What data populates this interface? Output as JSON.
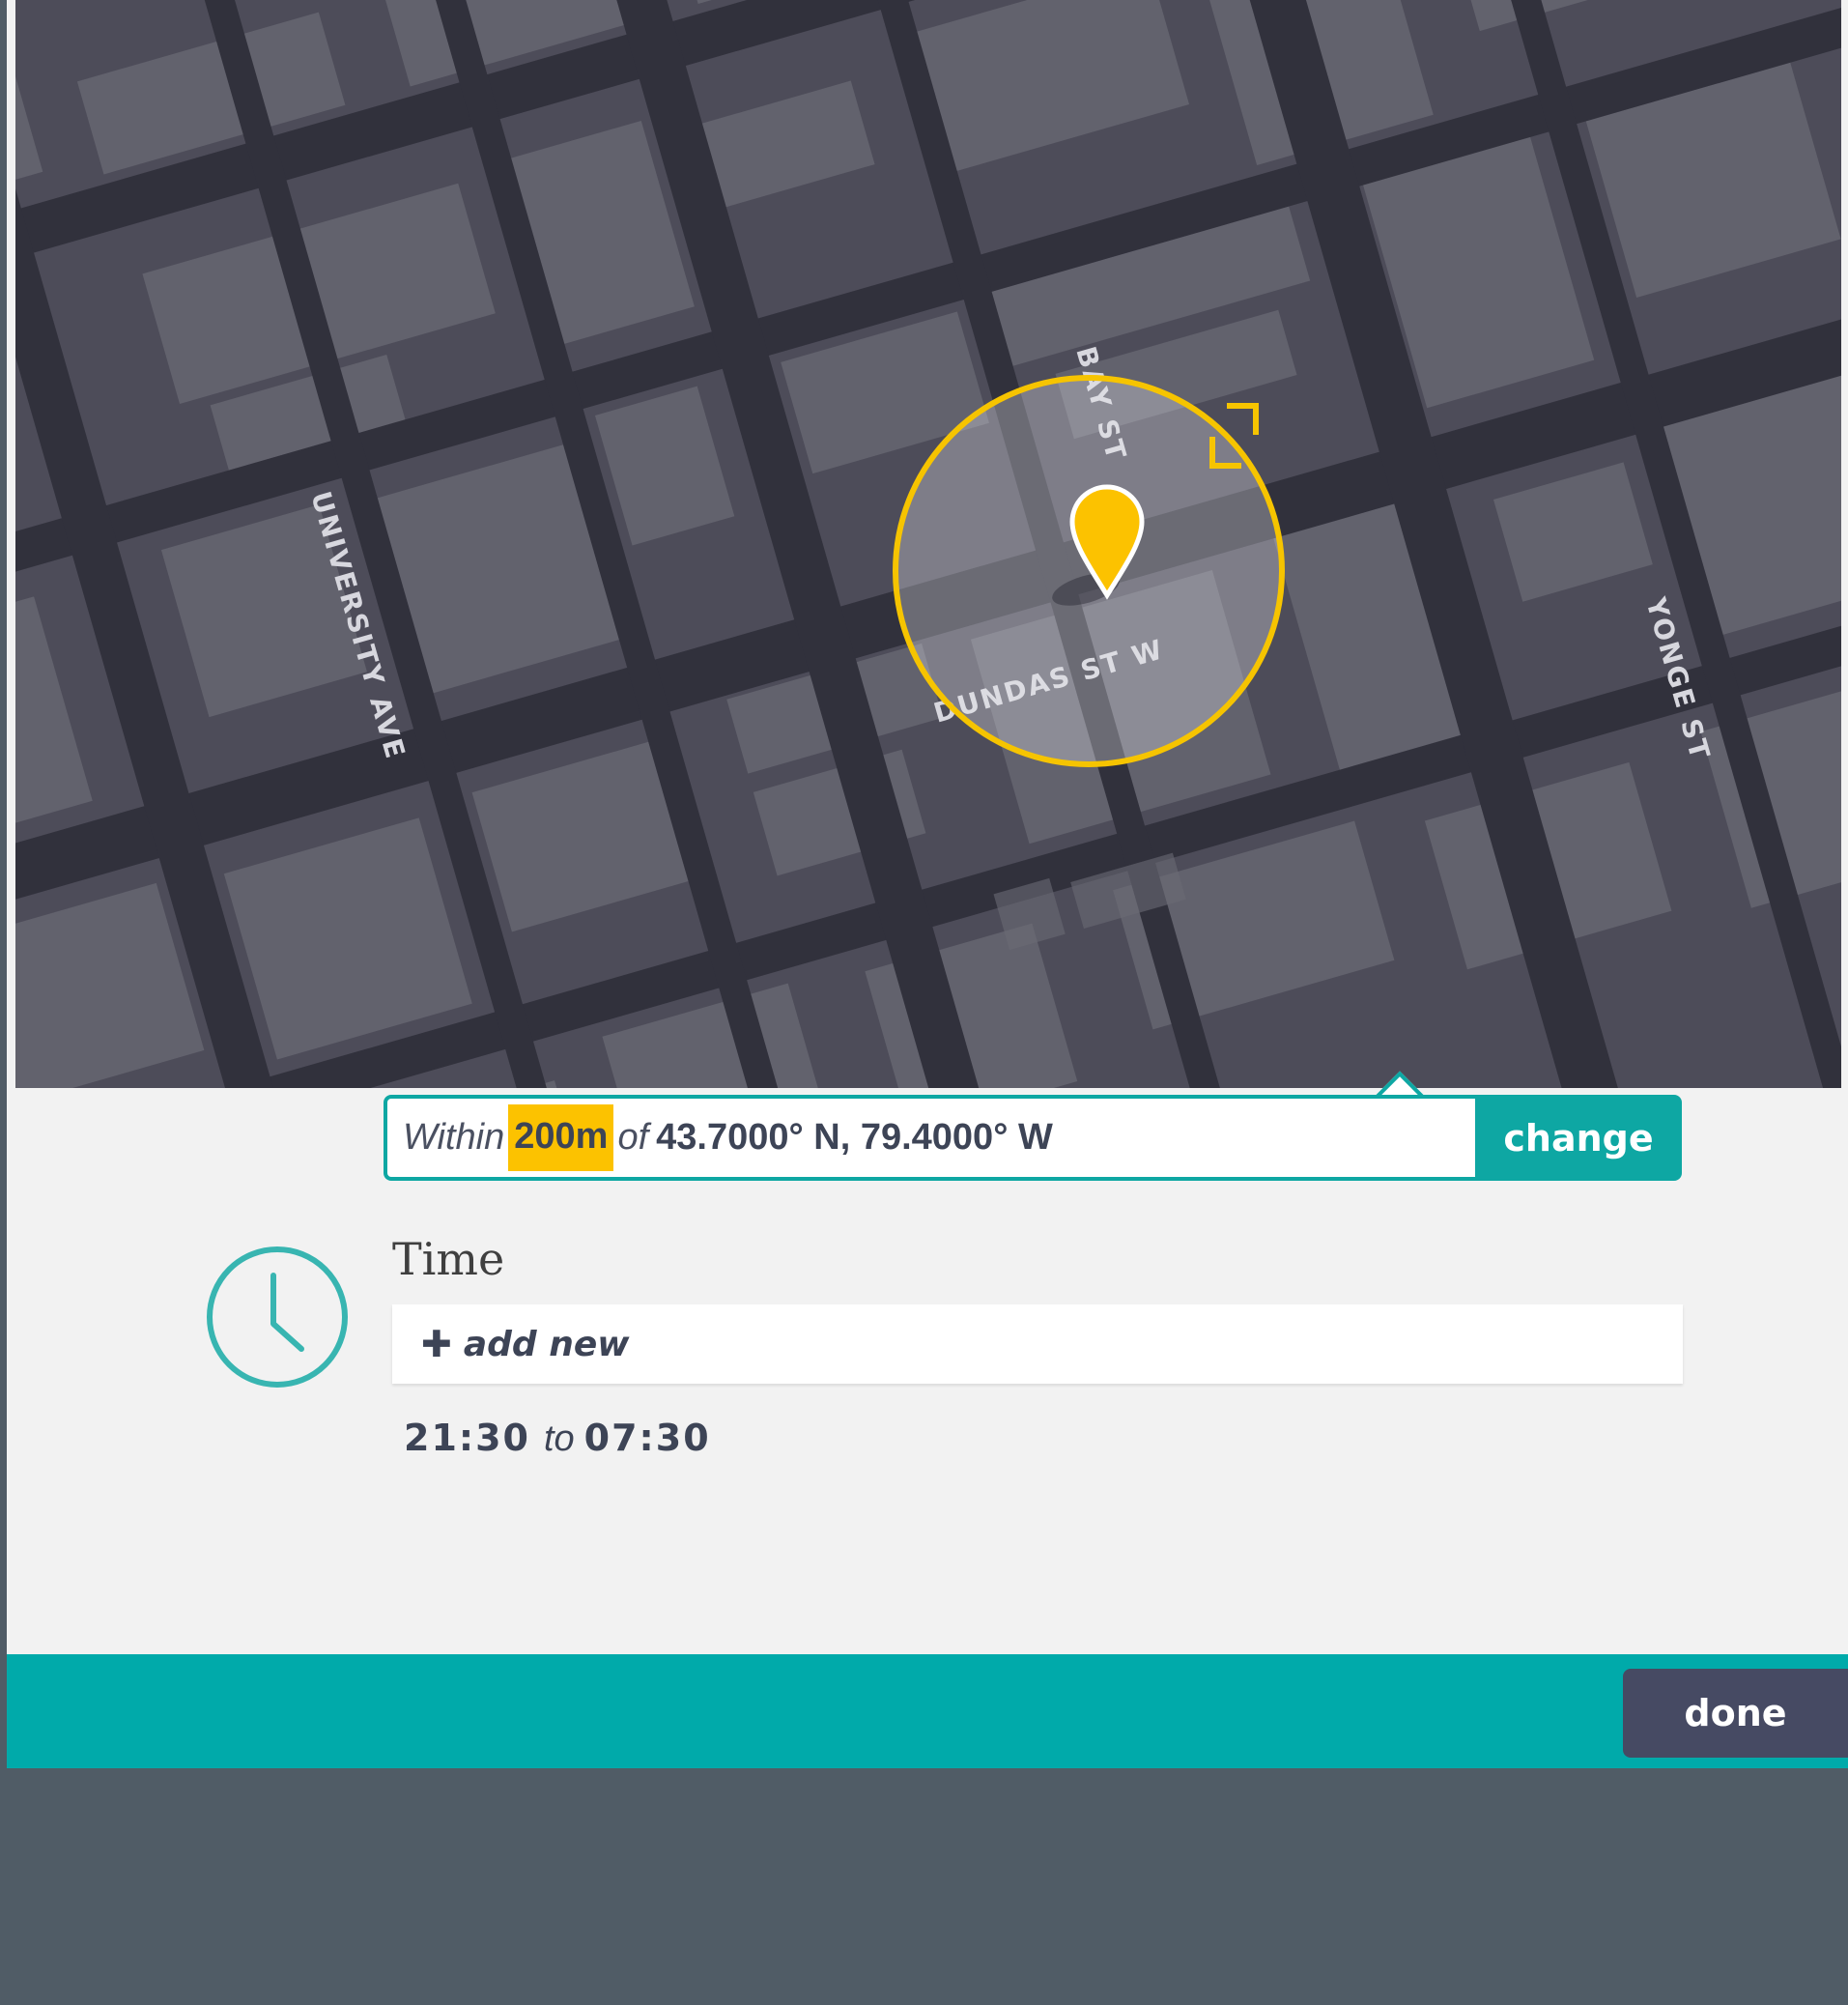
{
  "map": {
    "streets": {
      "bay_st": "BAY ST",
      "university_ave": "UNIVERSITY AVE",
      "dundas_st_w": "DUNDAS ST W",
      "yonge_st": "YONGE ST"
    },
    "geofence_radius": "200m"
  },
  "location_filter": {
    "within_label": "Within",
    "radius": "200m",
    "of_label": "of",
    "coordinates": "43.7000° N, 79.4000° W",
    "change_label": "change"
  },
  "time_section": {
    "title": "Time",
    "add_new_label": "add new",
    "range": {
      "start": "21:30",
      "separator": "to",
      "end": "07:30"
    }
  },
  "footer": {
    "done_label": "done"
  },
  "colors": {
    "accent_teal": "#00aaaa",
    "highlight_yellow": "#fcc200",
    "dark_navy": "#464a63",
    "map_road": "#31313c",
    "map_block": "#4d4c59",
    "map_building": "#62626d"
  },
  "icons": {
    "clock": "clock-icon",
    "pin": "map-pin-icon",
    "plus": "plus-icon",
    "expand": "expand-corner-icon"
  }
}
